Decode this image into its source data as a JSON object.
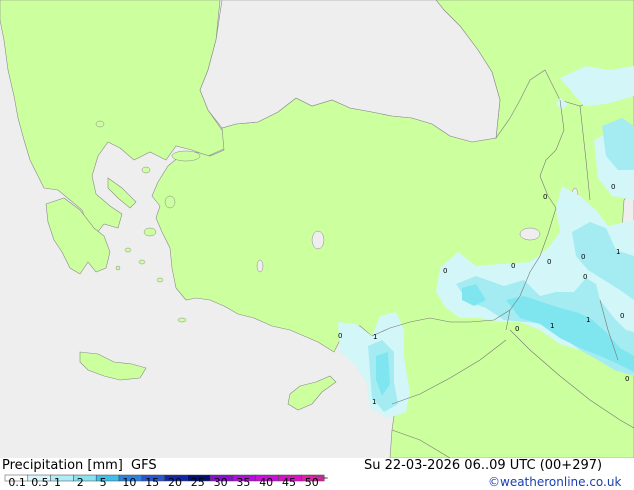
{
  "title": "Precipitation [mm]",
  "model": "GFS",
  "valid_time": "Su 22-03-2026 06..09 UTC (00+297)",
  "credit": "©weatheronline.co.uk",
  "legend": {
    "ticks": [
      "0.1",
      "0.5",
      "1",
      "2",
      "5",
      "10",
      "15",
      "20",
      "25",
      "30",
      "35",
      "40",
      "45",
      "50"
    ],
    "colors": [
      "#ffffff",
      "#d8f6fb",
      "#b0ecf6",
      "#88e2f0",
      "#40c0e8",
      "#2c84e0",
      "#2858d0",
      "#1028a8",
      "#001070",
      "#8a10d0",
      "#b010d8",
      "#c810d8",
      "#d810c8",
      "#e020a8"
    ]
  },
  "colors": {
    "land": "#ccff9e",
    "sea": "#eeeeee",
    "precip_light": "#d3f6f8",
    "precip_medium": "#a4ecf2",
    "precip_heavy": "#7fe6f0"
  },
  "precip_labels": [
    {
      "id": "p1",
      "text": "0"
    },
    {
      "id": "p2",
      "text": "0"
    },
    {
      "id": "p3",
      "text": "0"
    },
    {
      "id": "p4",
      "text": "0"
    },
    {
      "id": "p5",
      "text": "0"
    },
    {
      "id": "p6",
      "text": "0"
    },
    {
      "id": "p7",
      "text": "1"
    },
    {
      "id": "p8",
      "text": "1"
    },
    {
      "id": "p9",
      "text": "1"
    },
    {
      "id": "p10",
      "text": "0"
    },
    {
      "id": "p11",
      "text": "0"
    },
    {
      "id": "p12",
      "text": "1"
    },
    {
      "id": "p13",
      "text": "0"
    },
    {
      "id": "p14",
      "text": "1"
    },
    {
      "id": "p15",
      "text": "0"
    },
    {
      "id": "p16",
      "text": "0"
    }
  ]
}
